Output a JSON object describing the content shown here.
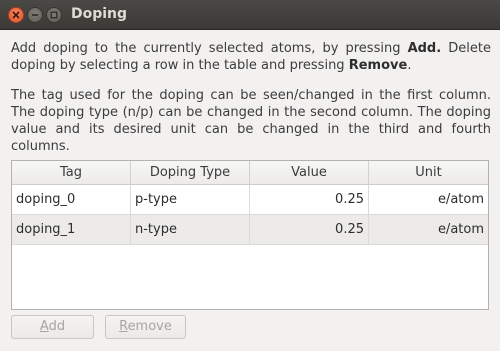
{
  "window": {
    "title": "Doping"
  },
  "description": {
    "p1_pre": "Add doping to the currently selected atoms, by pressing ",
    "p1_add": "Add.",
    "p1_mid": " Delete doping by selecting a row in the table and pressing ",
    "p1_remove": "Remove",
    "p1_end": ".",
    "p2": "The tag used for the doping can be seen/changed in the first column. The doping type (n/p) can be changed in the second column. The doping value and its desired unit can be changed in the third and fourth columns."
  },
  "table": {
    "headers": [
      "Tag",
      "Doping Type",
      "Value",
      "Unit"
    ],
    "rows": [
      [
        "doping_0",
        "p-type",
        "0.25",
        "e/atom"
      ],
      [
        "doping_1",
        "n-type",
        "0.25",
        "e/atom"
      ]
    ]
  },
  "buttons": {
    "add_mnemonic": "A",
    "add_rest": "dd",
    "remove_mnemonic": "R",
    "remove_rest": "emove",
    "enabled": false
  }
}
